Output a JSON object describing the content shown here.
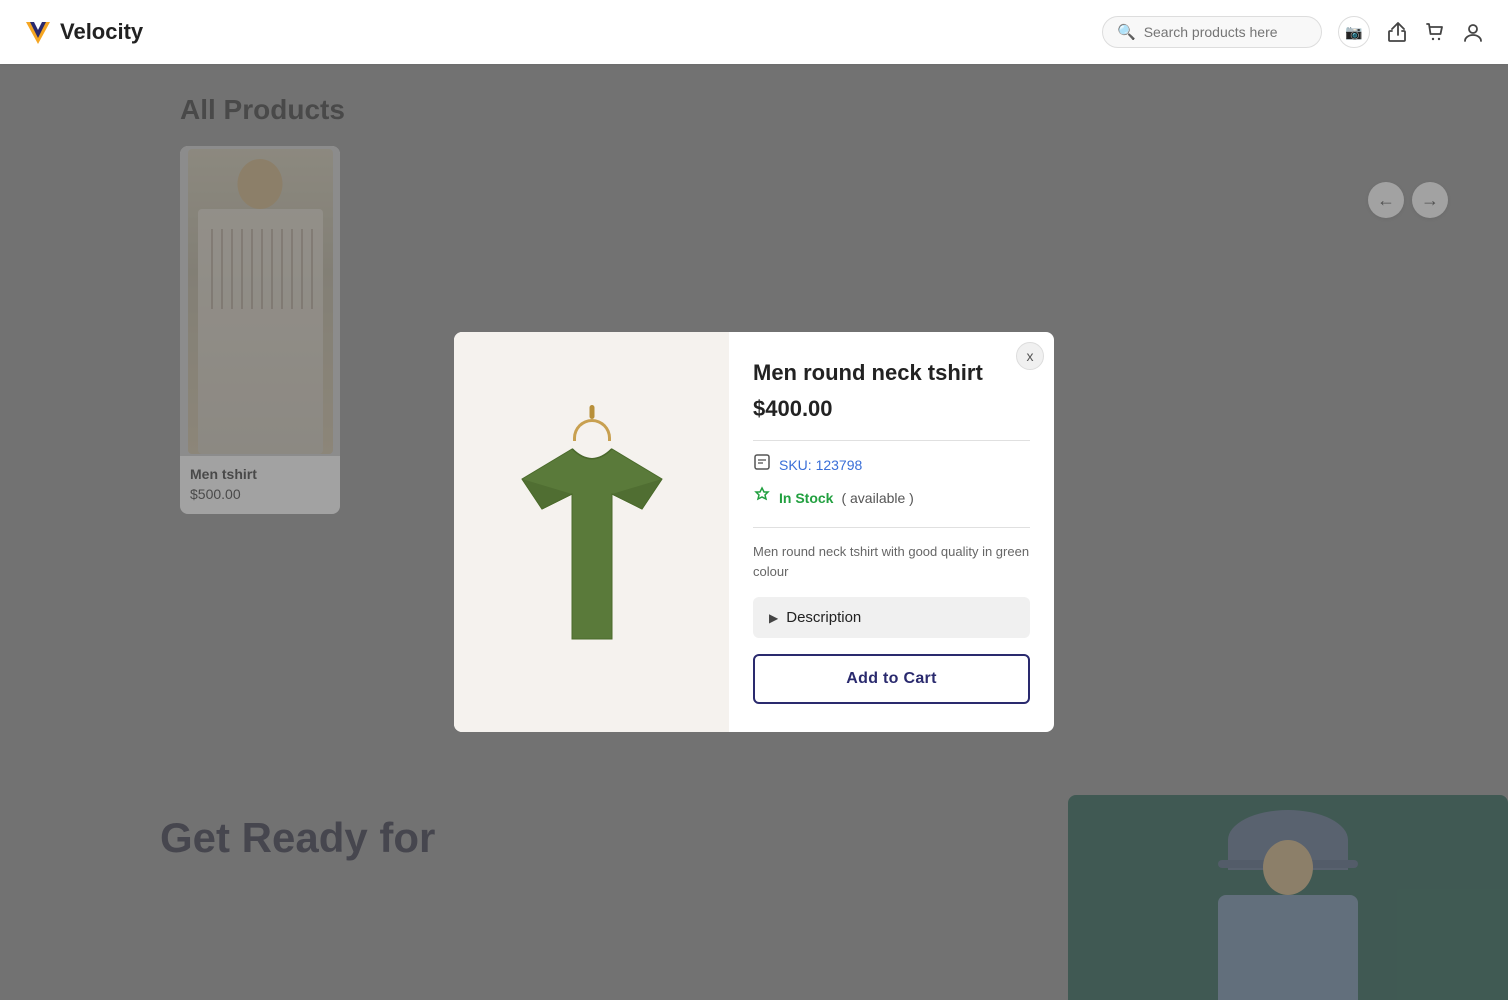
{
  "header": {
    "logo_text": "Velocity",
    "logo_icon": "V",
    "search_placeholder": "Search products here",
    "icons": {
      "camera": "📷",
      "share": "↩",
      "cart": "🛍",
      "user": "👤"
    }
  },
  "page": {
    "all_products_title": "All Products",
    "nav_prev": "←",
    "nav_next": "→"
  },
  "background_product": {
    "name": "Men tshirt",
    "price": "$500.00"
  },
  "bottom_banner": {
    "text_line1": "Get Ready for"
  },
  "modal": {
    "close_label": "x",
    "product_title": "Men round neck tshirt",
    "price": "$400.00",
    "sku_label": "SKU: 123798",
    "in_stock_label": "In Stock",
    "available_label": "( available )",
    "description_text": "Men round neck tshirt with good quality in green colour",
    "description_accordion_label": "Description",
    "add_to_cart_label": "Add to Cart"
  }
}
